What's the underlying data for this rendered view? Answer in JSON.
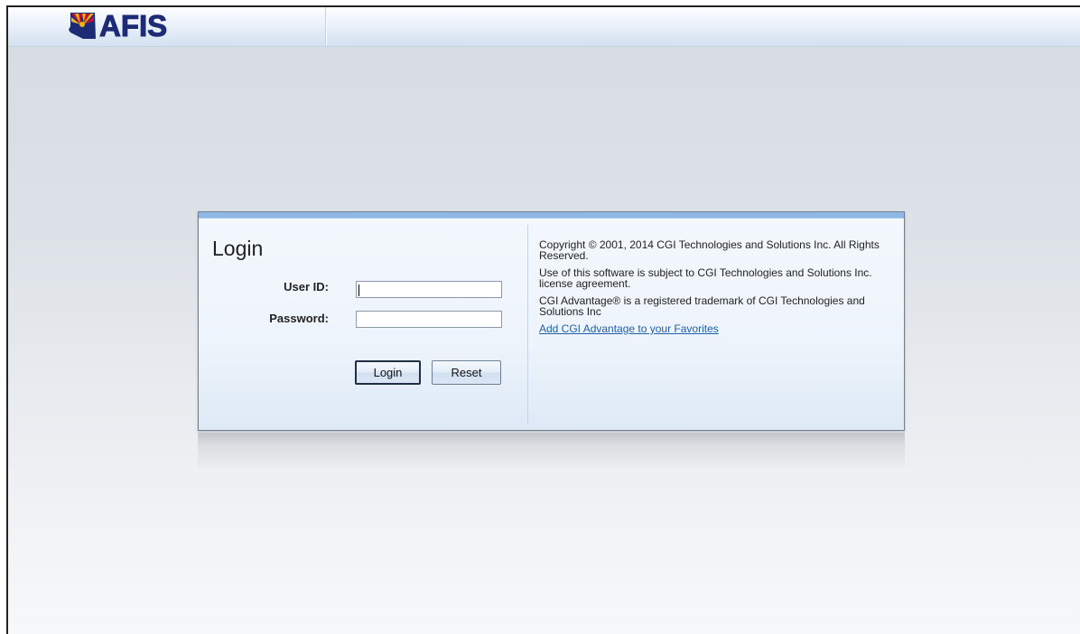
{
  "header": {
    "logo_text": "AFIS"
  },
  "login": {
    "title": "Login",
    "user_id_label": "User ID:",
    "user_id_value": "",
    "password_label": "Password:",
    "password_value": "",
    "login_button": "Login",
    "reset_button": "Reset"
  },
  "info": {
    "copyright": "Copyright © 2001, 2014 CGI Technologies and Solutions Inc. All Rights Reserved.",
    "license": "Use of this software is subject to CGI Technologies and Solutions Inc. license agreement.",
    "trademark": "CGI Advantage® is a registered trademark of CGI Technologies and Solutions Inc",
    "favorites_link": "Add CGI Advantage to your Favorites"
  },
  "colors": {
    "logo_blue": "#1d2b75",
    "logo_sunburst_red": "#c8102e",
    "logo_sunburst_gold": "#f2b318",
    "link_blue": "#1f5ea8",
    "panel_accent": "#8fb8e4"
  },
  "icons": {
    "logo_mark": "arizona-state-sunburst-icon"
  }
}
